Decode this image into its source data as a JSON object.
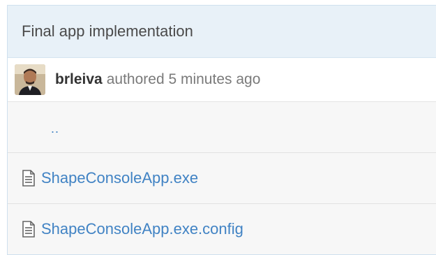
{
  "commit": {
    "message": "Final app implementation",
    "author": "brleiva",
    "authored_text": "authored 5 minutes ago"
  },
  "files": [
    {
      "name": "..",
      "type": "parent",
      "icon": ""
    },
    {
      "name": "ShapeConsoleApp.exe",
      "type": "file",
      "icon": "file-text-icon"
    },
    {
      "name": "ShapeConsoleApp.exe.config",
      "type": "file",
      "icon": "file-text-icon"
    }
  ],
  "colors": {
    "link": "#4183c4",
    "header_bg": "#e8f1f8",
    "row_bg": "#f7f7f7"
  }
}
